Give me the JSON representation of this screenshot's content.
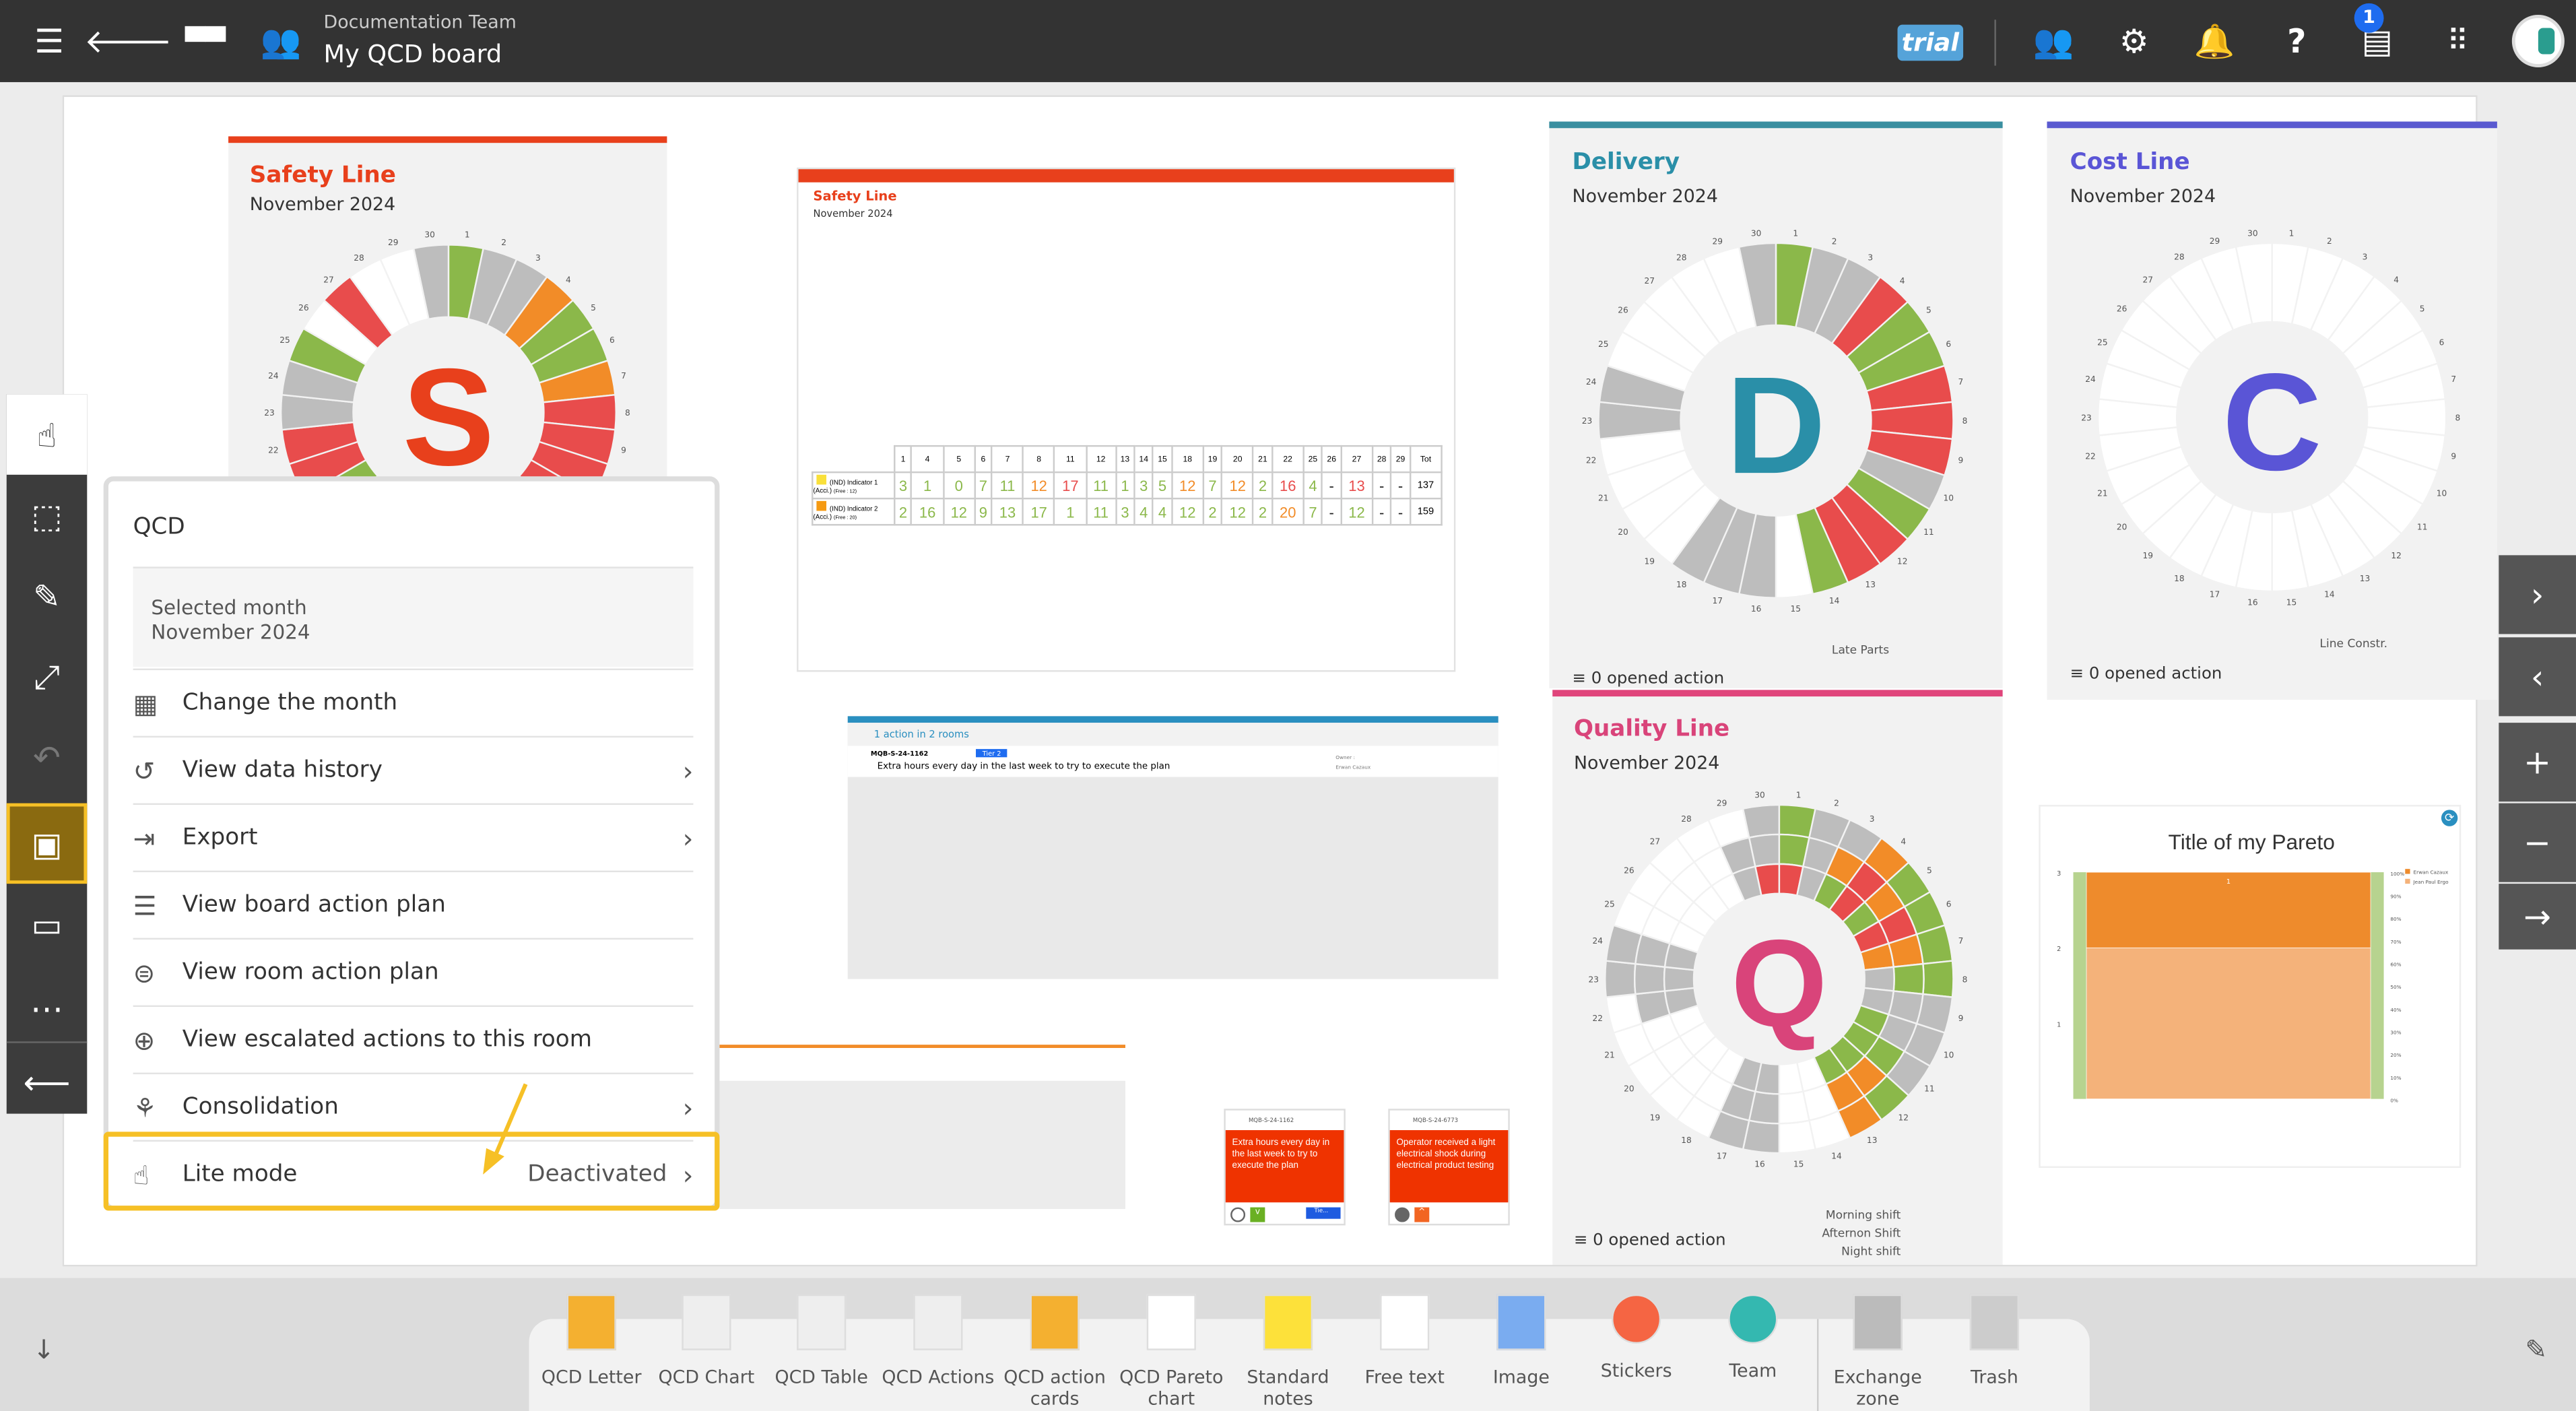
{
  "header": {
    "team": "Documentation Team",
    "board_title": "My QCD board",
    "trial_badge": "trial",
    "notification_count": "1"
  },
  "colors": {
    "green": "#8bb84a",
    "red": "#e84c4c",
    "orange": "#f28c28",
    "grey": "#bdbdbd",
    "empty": "#ffffff",
    "safety": "#e8401c",
    "delivery": "#2a8fa8",
    "quality": "#d9447a",
    "cost": "#5a55d6",
    "highlight": "#f6c026"
  },
  "letters": {
    "safety": {
      "title": "Safety Line",
      "month": "November 2024",
      "letter": "S",
      "days_in_month": 30,
      "rings": [
        [
          "g",
          "s",
          "s",
          "o",
          "g",
          "g",
          "o",
          "r",
          "r",
          "r",
          "r",
          "g",
          "r",
          "g",
          "w",
          "w",
          "w",
          "w",
          "w",
          "g",
          "r",
          "r",
          "s",
          "s",
          "g",
          "w",
          "r",
          "w",
          "w",
          "s"
        ]
      ]
    },
    "delivery": {
      "title": "Delivery",
      "month": "November 2024",
      "letter": "D",
      "days_in_month": 30,
      "legend": [
        "Late Parts"
      ],
      "actions": "0 opened action",
      "rings": [
        [
          "g",
          "s",
          "s",
          "r",
          "g",
          "g",
          "r",
          "r",
          "r",
          "s",
          "g",
          "r",
          "r",
          "g",
          "w",
          "s",
          "s",
          "s",
          "w",
          "w",
          "w",
          "w",
          "s",
          "s",
          "w",
          "w",
          "w",
          "w",
          "w",
          "s"
        ]
      ]
    },
    "cost": {
      "title": "Cost Line",
      "month": "November 2024",
      "letter": "C",
      "days_in_month": 30,
      "legend": [
        "Line Constr."
      ],
      "actions": "0 opened action",
      "rings": [
        [
          "w",
          "w",
          "w",
          "w",
          "w",
          "w",
          "w",
          "w",
          "w",
          "w",
          "w",
          "w",
          "w",
          "w",
          "w",
          "w",
          "w",
          "w",
          "w",
          "w",
          "w",
          "w",
          "w",
          "w",
          "w",
          "w",
          "w",
          "w",
          "w",
          "w"
        ]
      ]
    },
    "quality": {
      "title": "Quality Line",
      "month": "November 2024",
      "letter": "Q",
      "days_in_month": 30,
      "legend": [
        "Morning shift",
        "Afternon Shift",
        "Night shift"
      ],
      "actions": "0 opened action",
      "rings": [
        [
          "g",
          "s",
          "s",
          "o",
          "g",
          "g",
          "g",
          "g",
          "s",
          "s",
          "s",
          "g",
          "o",
          "w",
          "w",
          "s",
          "s",
          "w",
          "w",
          "w",
          "w",
          "w",
          "s",
          "s",
          "w",
          "w",
          "w",
          "w",
          "w",
          "s"
        ],
        [
          "g",
          "s",
          "o",
          "r",
          "o",
          "r",
          "o",
          "g",
          "s",
          "s",
          "g",
          "o",
          "o",
          "w",
          "w",
          "s",
          "s",
          "w",
          "w",
          "w",
          "w",
          "s",
          "s",
          "s",
          "w",
          "w",
          "w",
          "w",
          "s",
          "s"
        ],
        [
          "r",
          "s",
          "g",
          "r",
          "g",
          "r",
          "o",
          "s",
          "s",
          "g",
          "g",
          "g",
          "g",
          "w",
          "w",
          "s",
          "s",
          "w",
          "w",
          "w",
          "w",
          "s",
          "s",
          "s",
          "w",
          "w",
          "w",
          "w",
          "s",
          "r"
        ]
      ]
    }
  },
  "safety_table": {
    "title": "Safety Line",
    "month": "November 2024",
    "columns": [
      "1",
      "4",
      "5",
      "6",
      "7",
      "8",
      "11",
      "12",
      "13",
      "14",
      "15",
      "18",
      "19",
      "20",
      "21",
      "22",
      "25",
      "26",
      "27",
      "28",
      "29",
      "Tot"
    ],
    "rows": [
      {
        "label": "(IND) Indicator 1",
        "unit": "(Acci.)",
        "free": "(Free : 12)",
        "swatch": "#f9e03a",
        "values": [
          "3",
          "1",
          "0",
          "7",
          "11",
          "12",
          "17",
          "11",
          "1",
          "3",
          "5",
          "12",
          "7",
          "12",
          "2",
          "16",
          "4",
          "-",
          "13",
          "-",
          "-"
        ],
        "status": [
          "g",
          "g",
          "g",
          "g",
          "g",
          "o",
          "r",
          "g",
          "g",
          "g",
          "g",
          "o",
          "g",
          "o",
          "g",
          "r",
          "g",
          "k",
          "r",
          "k",
          "k"
        ],
        "total": "137"
      },
      {
        "label": "(IND) Indicator 2",
        "unit": "(Acci.)",
        "free": "(Free : 20)",
        "swatch": "#f59a12",
        "values": [
          "2",
          "16",
          "12",
          "9",
          "13",
          "17",
          "1",
          "11",
          "3",
          "4",
          "4",
          "12",
          "2",
          "12",
          "2",
          "20",
          "7",
          "-",
          "12",
          "-",
          "-"
        ],
        "status": [
          "g",
          "g",
          "g",
          "g",
          "g",
          "g",
          "g",
          "g",
          "g",
          "g",
          "g",
          "g",
          "g",
          "g",
          "g",
          "o",
          "g",
          "k",
          "g",
          "k",
          "k"
        ],
        "total": "159"
      }
    ]
  },
  "action_plan": {
    "title": "1 action in 2 rooms",
    "item": {
      "id": "MQB-S-24-1162",
      "tag": "Tier 2",
      "text": "Extra hours every day in the last week to try to execute the plan",
      "owner_label": "Owner :",
      "owner": "Erwan Cazaux"
    }
  },
  "cards": [
    {
      "id": "MQB-S-24-1162",
      "text": "Extra hours every day in the last week to try to execute the plan",
      "tag": "Tie..."
    },
    {
      "id": "MQB-S-24-6773",
      "text": "Operator received a light electrical shock during electrical product testing"
    }
  ],
  "chart_data": {
    "type": "bar",
    "title": "Title of my Pareto",
    "categories": [
      ""
    ],
    "series": [
      {
        "name": "Erwan Cazaux",
        "values": [
          1
        ]
      },
      {
        "name": "Jean Paul Ergo",
        "values": [
          2
        ]
      }
    ],
    "ylim": [
      0,
      3
    ],
    "y_ticks": [
      "3",
      "2",
      "1"
    ],
    "y2_ticks": [
      "100%",
      "90%",
      "80%",
      "70%",
      "60%",
      "50%",
      "40%",
      "30%",
      "20%",
      "10%",
      "0%"
    ],
    "data_label": "1",
    "legend_position": "right",
    "grid": false
  },
  "menu": {
    "title": "QCD",
    "selected_label": "Selected month",
    "selected_value": "November 2024",
    "items": [
      {
        "label": "Change the month",
        "icon": "calendar-icon",
        "glyph": "▦",
        "chev": ""
      },
      {
        "label": "View data history",
        "icon": "history-icon",
        "glyph": "↺",
        "chev": "›"
      },
      {
        "label": "Export",
        "icon": "export-icon",
        "glyph": "⇥",
        "chev": "›"
      },
      {
        "label": "View board action plan",
        "icon": "list-icon",
        "glyph": "☰",
        "chev": ""
      },
      {
        "label": "View room action plan",
        "icon": "room-action-plan-icon",
        "glyph": "⊜",
        "chev": ""
      },
      {
        "label": "View escalated actions to this room",
        "icon": "escalated-actions-icon",
        "glyph": "⊕",
        "chev": ""
      },
      {
        "label": "Consolidation",
        "icon": "hierarchy-icon",
        "glyph": "⚘",
        "chev": "›"
      },
      {
        "label": "Lite mode",
        "icon": "lite-mode-icon",
        "glyph": "☝",
        "chev": "›",
        "value": "Deactivated"
      }
    ]
  },
  "toolbar": [
    {
      "label": "QCD Letter",
      "icon": "qcd-letter-icon"
    },
    {
      "label": "QCD Chart",
      "icon": "qcd-chart-icon"
    },
    {
      "label": "QCD Table",
      "icon": "qcd-table-icon"
    },
    {
      "label": "QCD Actions",
      "icon": "qcd-actions-icon"
    },
    {
      "label": "QCD action cards",
      "icon": "qcd-action-cards-icon"
    },
    {
      "label": "QCD Pareto chart",
      "icon": "qcd-pareto-icon"
    },
    {
      "label": "Standard notes",
      "icon": "sticky-note-icon"
    },
    {
      "label": "Free text",
      "icon": "free-text-icon"
    },
    {
      "label": "Image",
      "icon": "image-icon"
    },
    {
      "label": "Stickers",
      "icon": "sticker-icon"
    },
    {
      "label": "Team",
      "icon": "team-icon"
    },
    {
      "label": "Exchange zone",
      "icon": "exchange-zone-icon"
    },
    {
      "label": "Trash",
      "icon": "trash-icon"
    }
  ]
}
